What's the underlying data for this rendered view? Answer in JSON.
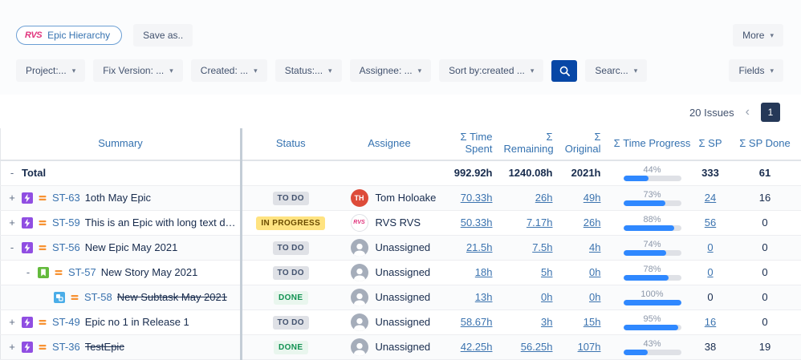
{
  "toolbar": {
    "report_badge": {
      "logo": "RVS",
      "label": "Epic Hierarchy"
    },
    "save_as": "Save as..",
    "more": "More"
  },
  "filterbar": {
    "filters": [
      "Project:...",
      "Fix Version: ...",
      "Created: ...",
      "Status:...",
      "Assignee: ...",
      "Sort by:created ..."
    ],
    "search_label": "Searc...",
    "fields": "Fields"
  },
  "glyphs": {
    "chevron_down": "▾"
  },
  "pagination": {
    "count_label": "20 Issues",
    "prev": "‹",
    "page": "1"
  },
  "colors": {
    "link": "#3b73af",
    "header_blue": "#3572b0",
    "progress_fill": "#2f88ff",
    "search_button": "#0747a6",
    "page_button": "#253858",
    "epic_icon": "#904ee2",
    "story_icon": "#63ba3c",
    "subtask_icon": "#4bade8",
    "priority_medium": "#f79232",
    "rvs_pink": "#e0337c",
    "avatar_tom": "#dd4b39",
    "lozenge_todo_bg": "#dfe1e6",
    "lozenge_inprogress_bg": "#ffe380",
    "lozenge_done_text": "#109151"
  },
  "table": {
    "columns": [
      "Summary",
      "Status",
      "Assignee",
      "Σ Time Spent",
      "Σ Remaining",
      "Σ Original",
      "Σ Time Progress",
      "Σ SP",
      "Σ SP Done"
    ],
    "rows": [
      {
        "is_total": true,
        "indent": 0,
        "toggle": "-",
        "type": null,
        "key": null,
        "summary": "Total",
        "strike": false,
        "status": null,
        "assignee": null,
        "spent": "992.92h",
        "remaining": "1240.08h",
        "original": "2021h",
        "links": false,
        "progress_pct": 44,
        "progress_label": "44%",
        "sp": "333",
        "sp_link": false,
        "sp_done": "61"
      },
      {
        "is_total": false,
        "indent": 0,
        "toggle": "+",
        "type": "epic",
        "key": "ST-63",
        "summary": "1oth May Epic",
        "strike": false,
        "status": {
          "label": "TO DO",
          "kind": "todo"
        },
        "assignee": {
          "name": "Tom Holoake",
          "avatar": "initials",
          "initials": "TH",
          "color": "#dd4b39"
        },
        "spent": "70.33h",
        "remaining": "26h",
        "original": "49h",
        "links": true,
        "progress_pct": 73,
        "progress_label": "73%",
        "sp": "24",
        "sp_link": true,
        "sp_done": "16"
      },
      {
        "is_total": false,
        "indent": 0,
        "toggle": "+",
        "type": "epic",
        "key": "ST-59",
        "summary": "This is an Epic with long text description",
        "strike": false,
        "status": {
          "label": "IN PROGRESS",
          "kind": "inprogress"
        },
        "assignee": {
          "name": "RVS RVS",
          "avatar": "rvs",
          "initials": "RVS"
        },
        "spent": "50.33h",
        "remaining": "7.17h",
        "original": "26h",
        "links": true,
        "progress_pct": 88,
        "progress_label": "88%",
        "sp": "56",
        "sp_link": true,
        "sp_done": "0"
      },
      {
        "is_total": false,
        "indent": 0,
        "toggle": "-",
        "type": "epic",
        "key": "ST-56",
        "summary": "New Epic May 2021",
        "strike": false,
        "status": {
          "label": "TO DO",
          "kind": "todo"
        },
        "assignee": {
          "name": "Unassigned",
          "avatar": "unassigned"
        },
        "spent": "21.5h",
        "remaining": "7.5h",
        "original": "4h",
        "links": true,
        "progress_pct": 74,
        "progress_label": "74%",
        "sp": "0",
        "sp_link": true,
        "sp_done": "0"
      },
      {
        "is_total": false,
        "indent": 1,
        "toggle": "-",
        "type": "story",
        "key": "ST-57",
        "summary": "New Story May 2021",
        "strike": false,
        "status": {
          "label": "TO DO",
          "kind": "todo"
        },
        "assignee": {
          "name": "Unassigned",
          "avatar": "unassigned"
        },
        "spent": "18h",
        "remaining": "5h",
        "original": "0h",
        "links": true,
        "progress_pct": 78,
        "progress_label": "78%",
        "sp": "0",
        "sp_link": true,
        "sp_done": "0"
      },
      {
        "is_total": false,
        "indent": 2,
        "toggle": null,
        "type": "subtask",
        "key": "ST-58",
        "summary": "New Subtask May 2021",
        "strike": true,
        "status": {
          "label": "DONE",
          "kind": "done"
        },
        "assignee": {
          "name": "Unassigned",
          "avatar": "unassigned"
        },
        "spent": "13h",
        "remaining": "0h",
        "original": "0h",
        "links": true,
        "progress_pct": 100,
        "progress_label": "100%",
        "sp": "0",
        "sp_link": false,
        "sp_done": "0"
      },
      {
        "is_total": false,
        "indent": 0,
        "toggle": "+",
        "type": "epic",
        "key": "ST-49",
        "summary": "Epic no 1 in Release 1",
        "strike": false,
        "status": {
          "label": "TO DO",
          "kind": "todo"
        },
        "assignee": {
          "name": "Unassigned",
          "avatar": "unassigned"
        },
        "spent": "58.67h",
        "remaining": "3h",
        "original": "15h",
        "links": true,
        "progress_pct": 95,
        "progress_label": "95%",
        "sp": "16",
        "sp_link": true,
        "sp_done": "0"
      },
      {
        "is_total": false,
        "indent": 0,
        "toggle": "+",
        "type": "epic",
        "key": "ST-36",
        "summary": "TestEpic",
        "strike": true,
        "status": {
          "label": "DONE",
          "kind": "done"
        },
        "assignee": {
          "name": "Unassigned",
          "avatar": "unassigned"
        },
        "spent": "42.25h",
        "remaining": "56.25h",
        "original": "107h",
        "links": true,
        "progress_pct": 43,
        "progress_label": "43%",
        "sp": "38",
        "sp_link": false,
        "sp_done": "19"
      }
    ]
  }
}
